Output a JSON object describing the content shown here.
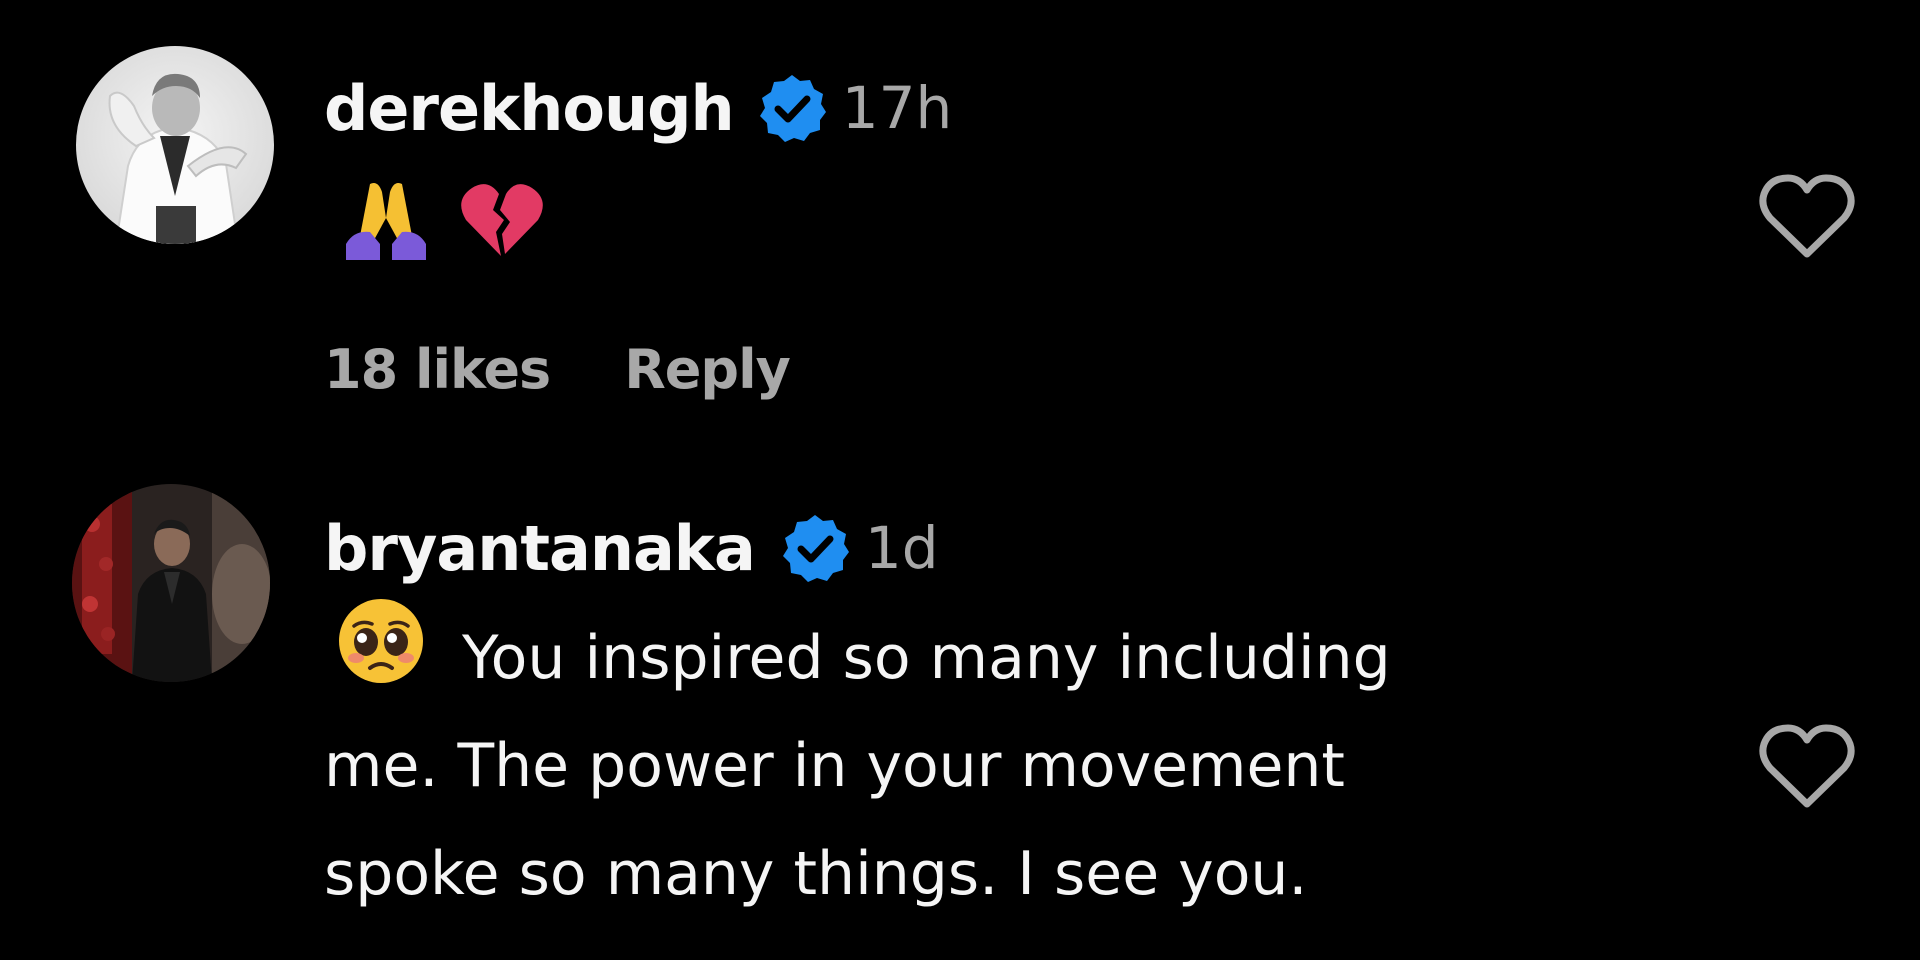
{
  "colors": {
    "background": "#000000",
    "text_primary": "#f5f5f5",
    "text_secondary": "#a8a8a8",
    "verified_badge": "#1f8ef1"
  },
  "comments": [
    {
      "username": "derekhough",
      "verified": true,
      "timestamp": "17h",
      "emojis": [
        "folded-hands-emoji",
        "broken-heart-emoji"
      ],
      "text": "",
      "likes_label": "18 likes",
      "reply_label": "Reply",
      "like_icon": "heart-outline-icon"
    },
    {
      "username": "bryantanaka",
      "verified": true,
      "timestamp": "1d",
      "emojis": [
        "pleading-face-emoji"
      ],
      "text_line_1": "You inspired so many including",
      "text_line_2": "me. The power in your movement",
      "text_line_3": "spoke so many things. I see you.",
      "like_icon": "heart-outline-icon"
    }
  ]
}
